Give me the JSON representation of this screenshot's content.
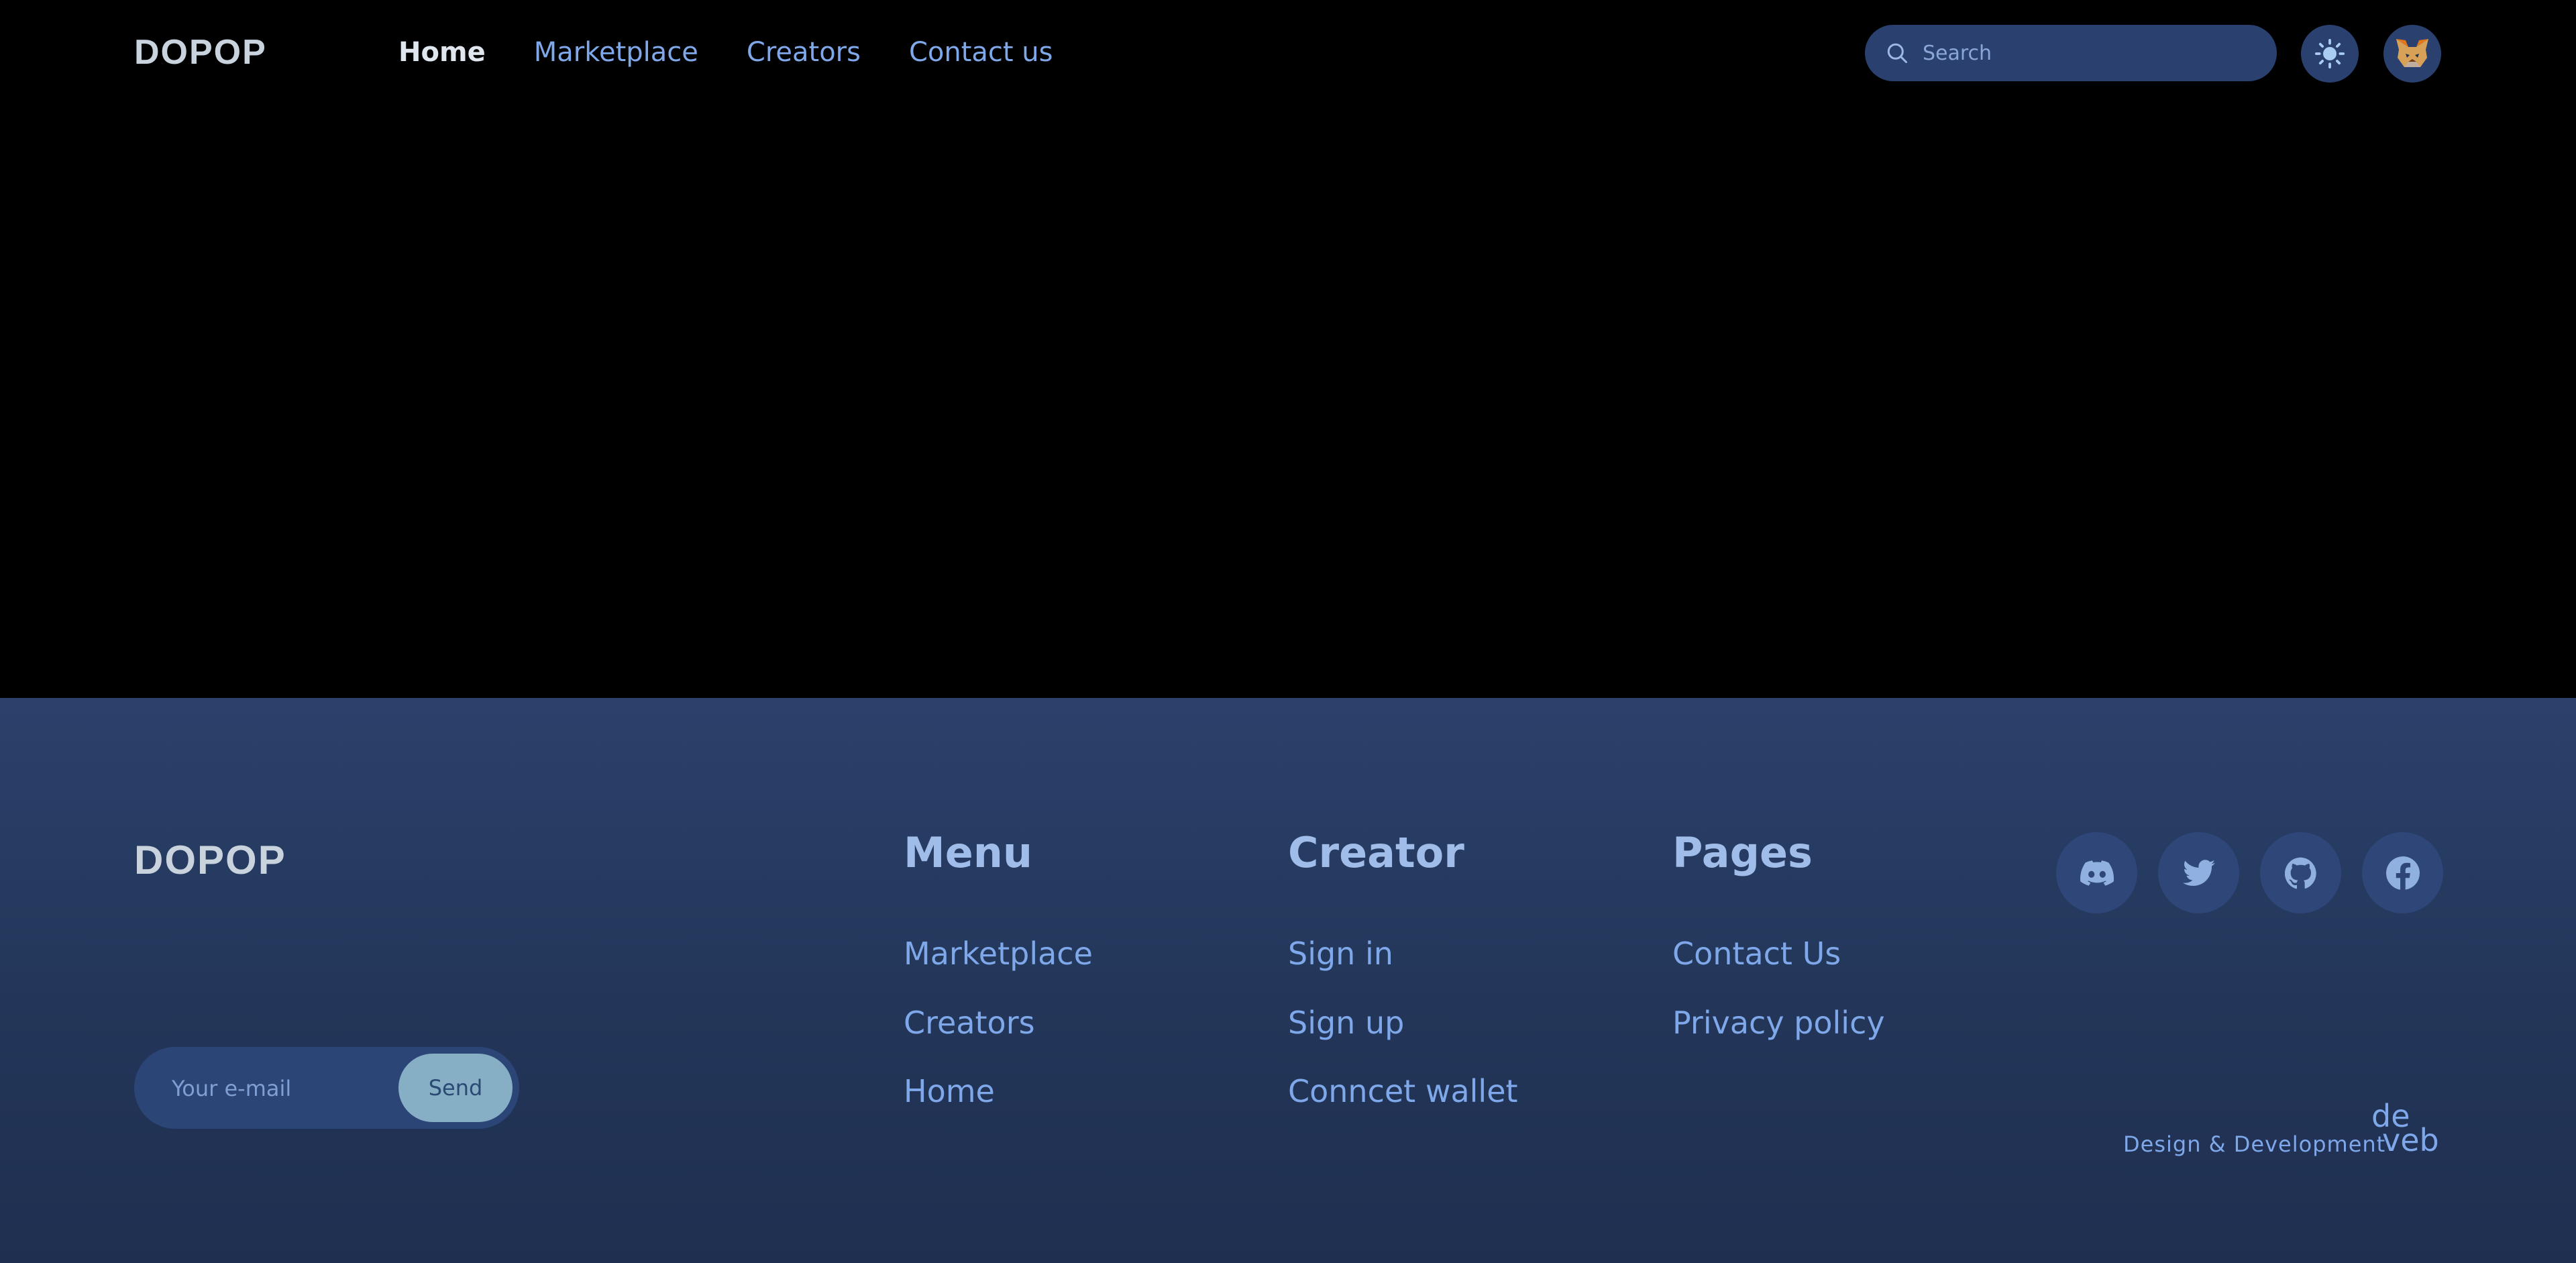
{
  "header": {
    "logo": "DOPOP",
    "nav": [
      {
        "label": "Home",
        "active": true
      },
      {
        "label": "Marketplace",
        "active": false
      },
      {
        "label": "Creators",
        "active": false
      },
      {
        "label": "Contact us",
        "active": false
      }
    ],
    "search": {
      "placeholder": "Search",
      "value": "",
      "icon": "search-icon"
    },
    "theme_toggle_icon": "sun-icon",
    "wallet_avatar_icon": "metamask-fox-icon"
  },
  "footer": {
    "logo": "DOPOP",
    "columns": {
      "menu": {
        "title": "Menu",
        "links": [
          "Marketplace",
          "Creators",
          "Home"
        ]
      },
      "creator": {
        "title": "Creator",
        "links": [
          "Sign in",
          "Sign up",
          "Conncet wallet"
        ]
      },
      "pages": {
        "title": "Pages",
        "links": [
          "Contact Us",
          "Privacy policy"
        ]
      }
    },
    "social": [
      "discord-icon",
      "twitter-icon",
      "github-icon",
      "facebook-icon"
    ],
    "newsletter": {
      "placeholder": "Your e-mail",
      "value": "",
      "button": "Send"
    },
    "credit": {
      "text": "Design & Development",
      "logo_line1": "de",
      "logo_line2": "veb"
    }
  },
  "colors": {
    "background": "#000000",
    "footer_bg": "#243760",
    "accent_link": "#7fa8ea",
    "pill_bg": "#2a4170",
    "send_button": "#86aec4"
  }
}
